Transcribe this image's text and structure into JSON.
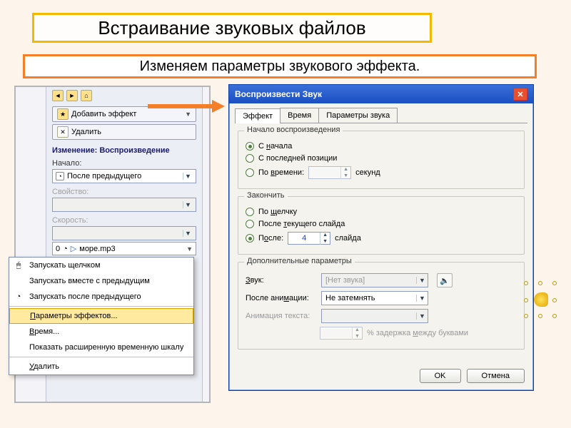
{
  "slide": {
    "title": "Встраивание звуковых файлов",
    "subtitle": "Изменяем параметры звукового эффекта."
  },
  "left_panel": {
    "add_effect": "Добавить эффект",
    "remove": "Удалить",
    "change_header": "Изменение: Воспроизведение",
    "start_label": "Начало:",
    "start_value": "После предыдущего",
    "property_label": "Свойство:",
    "speed_label": "Скорость:",
    "media_index": "0",
    "media_name": "море.mp3"
  },
  "context_menu": {
    "items": [
      "Запускать щелчком",
      "Запускать вместе с предыдущим",
      "Запускать после предыдущего",
      "Параметры эффектов...",
      "Время...",
      "Показать расширенную временную шкалу",
      "Удалить"
    ],
    "selected_index": 3
  },
  "dialog": {
    "title": "Воспроизвести Звук",
    "tabs": [
      "Эффект",
      "Время",
      "Параметры звука"
    ],
    "active_tab": 0,
    "group_start": {
      "title": "Начало воспроизведения",
      "opt_begin": "С начала",
      "opt_lastpos": "С последней позиции",
      "opt_time": "По времени:",
      "time_unit": "секунд",
      "selected": 0
    },
    "group_end": {
      "title": "Закончить",
      "opt_click": "По щелчку",
      "opt_current": "После текущего слайда",
      "opt_after": "После:",
      "after_value": "4",
      "after_unit": "слайда",
      "selected": 2
    },
    "group_extra": {
      "title": "Дополнительные параметры",
      "sound_label": "Звук:",
      "sound_value": "[Нет звука]",
      "after_anim_label": "После анимации:",
      "after_anim_value": "Не затемнять",
      "text_anim_label": "Анимация текста:",
      "delay_label": "% задержка между буквами"
    },
    "buttons": {
      "ok": "OK",
      "cancel": "Отмена"
    }
  }
}
